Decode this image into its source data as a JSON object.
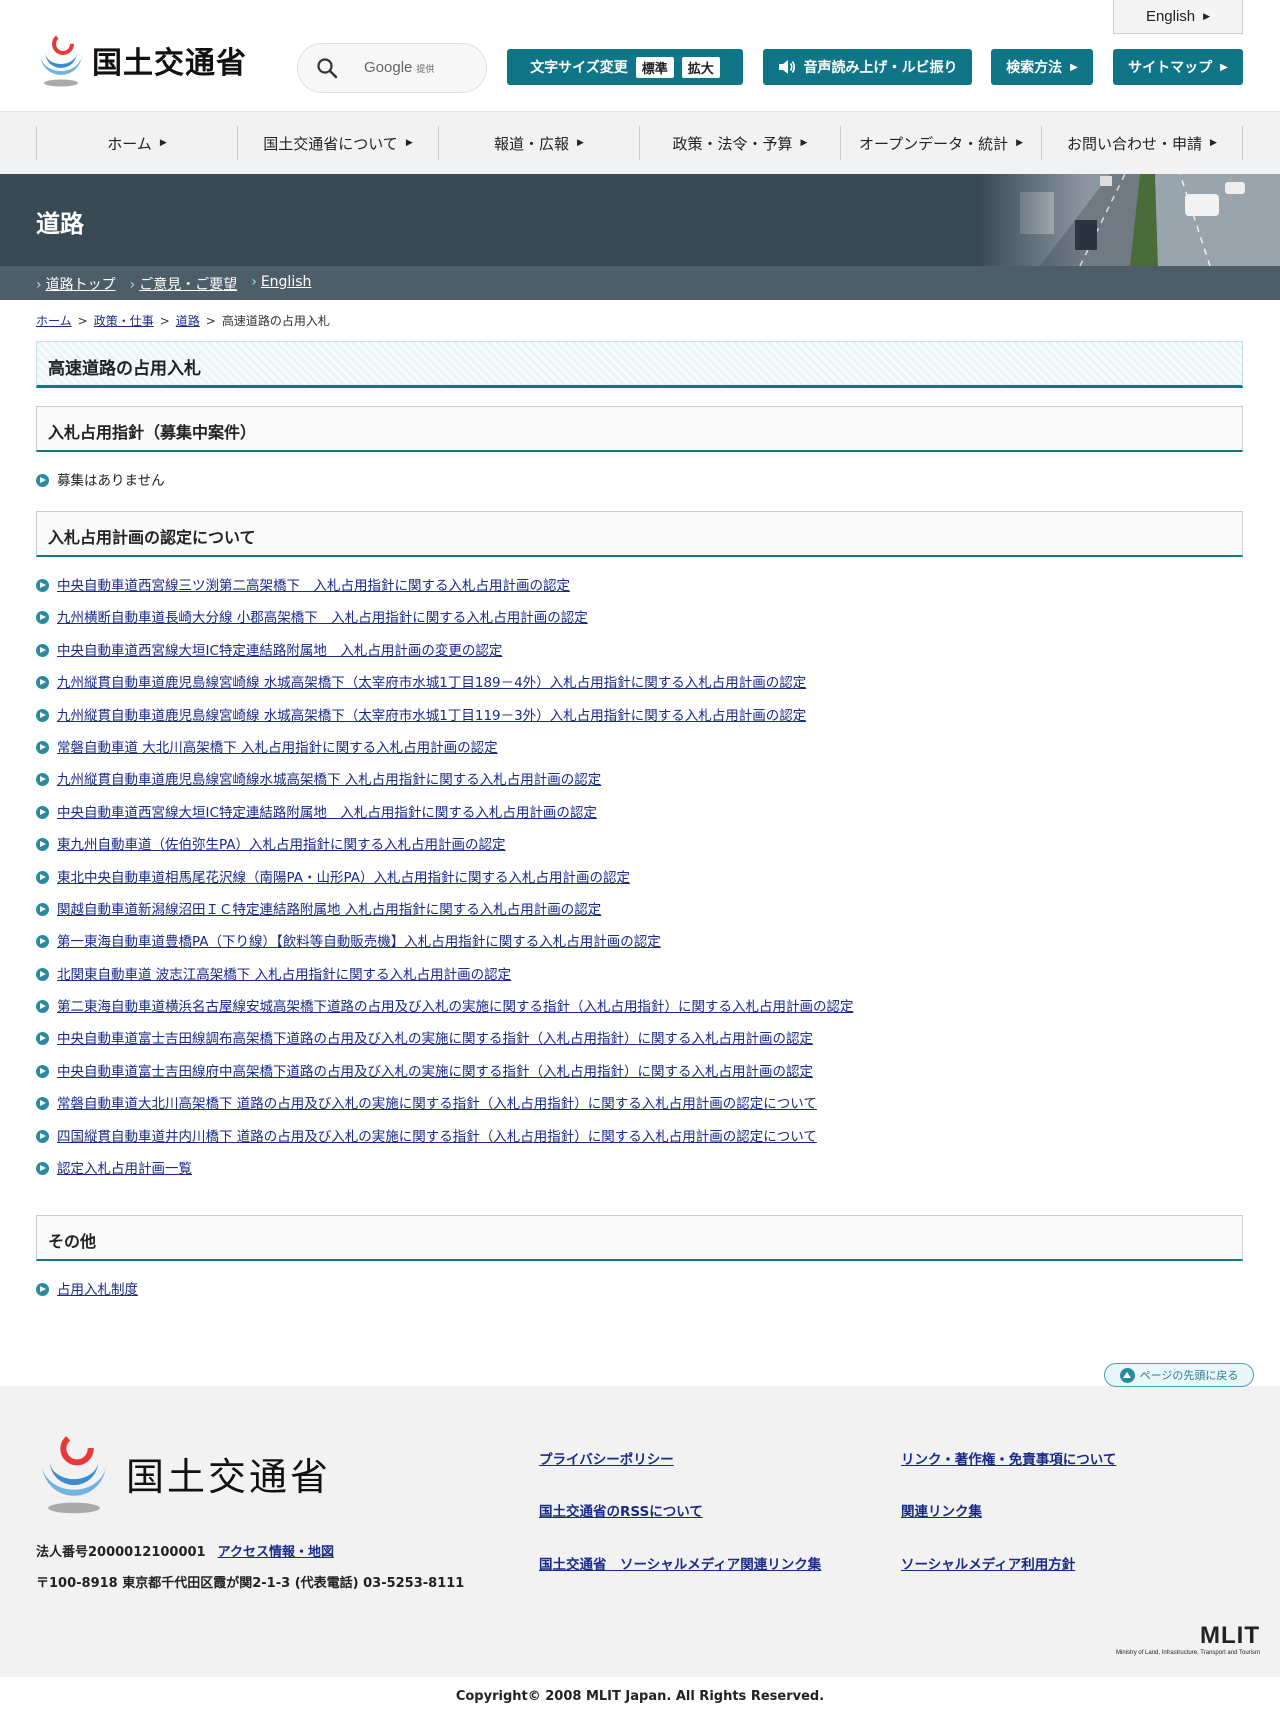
{
  "header": {
    "logo_text": "国土交通省",
    "search_provider": "Google",
    "search_provider_note": "提供",
    "font_size_label": "文字サイズ変更",
    "font_size_standard": "標準",
    "font_size_large": "拡大",
    "speech_label": "音声読み上げ・ルビ振り",
    "search_method_label": "検索方法",
    "sitemap_label": "サイトマップ",
    "english_label": "English",
    "accent_color": "#0f7587"
  },
  "gnav": {
    "items": [
      {
        "label": "ホーム"
      },
      {
        "label": "国土交通省について"
      },
      {
        "label": "報道・広報"
      },
      {
        "label": "政策・法令・予算"
      },
      {
        "label": "オープンデータ・統計"
      },
      {
        "label": "お問い合わせ・申請"
      }
    ]
  },
  "banner": {
    "title": "道路",
    "subnav": [
      "道路トップ",
      "ご意見・ご要望",
      "English"
    ]
  },
  "breadcrumb": {
    "items": [
      "ホーム",
      "政策・仕事",
      "道路"
    ],
    "current": "高速道路の占用入札"
  },
  "main": {
    "page_title": "高速道路の占用入札",
    "sections": [
      {
        "heading": "入札占用指針（募集中案件）",
        "items": [
          "募集はありません"
        ]
      },
      {
        "heading": "入札占用計画の認定について",
        "items": [
          "中央自動車道西宮線三ツ渕第二高架橋下　入札占用指針に関する入札占用計画の認定",
          "九州横断自動車道長崎大分線 小郡高架橋下　入札占用指針に関する入札占用計画の認定",
          "中央自動車道西宮線大垣IC特定連結路附属地　入札占用計画の変更の認定",
          "九州縦貫自動車道鹿児島線宮崎線 水城高架橋下（太宰府市水城1丁目189－4外）入札占用指針に関する入札占用計画の認定",
          "九州縦貫自動車道鹿児島線宮崎線 水城高架橋下（太宰府市水城1丁目119－3外）入札占用指針に関する入札占用計画の認定",
          "常磐自動車道 大北川高架橋下 入札占用指針に関する入札占用計画の認定",
          "九州縦貫自動車道鹿児島線宮崎線水城高架橋下 入札占用指針に関する入札占用計画の認定",
          "中央自動車道西宮線大垣IC特定連結路附属地　入札占用指針に関する入札占用計画の認定",
          "東九州自動車道（佐伯弥生PA）入札占用指針に関する入札占用計画の認定",
          "東北中央自動車道相馬尾花沢線（南陽PA・山形PA）入札占用指針に関する入札占用計画の認定",
          "関越自動車道新潟線沼田ＩＣ特定連結路附属地 入札占用指針に関する入札占用計画の認定",
          "第一東海自動車道豊橋PA（下り線）【飲料等自動販売機】入札占用指針に関する入札占用計画の認定",
          "北関東自動車道 波志江高架橋下 入札占用指針に関する入札占用計画の認定",
          "第二東海自動車道横浜名古屋線安城高架橋下道路の占用及び入札の実施に関する指針（入札占用指針）に関する入札占用計画の認定",
          "中央自動車道富士吉田線調布高架橋下道路の占用及び入札の実施に関する指針（入札占用指針）に関する入札占用計画の認定",
          "中央自動車道富士吉田線府中高架橋下道路の占用及び入札の実施に関する指針（入札占用指針）に関する入札占用計画の認定",
          "常磐自動車道大北川高架橋下 道路の占用及び入札の実施に関する指針（入札占用指針）に関する入札占用計画の認定について",
          "四国縦貫自動車道井内川橋下 道路の占用及び入札の実施に関する指針（入札占用指針）に関する入札占用計画の認定について",
          "認定入札占用計画一覧"
        ]
      },
      {
        "heading": "その他",
        "items": [
          "占用入札制度"
        ]
      }
    ],
    "page_top_label": "ページの先頭に戻る"
  },
  "footer": {
    "logo_text": "国土交通省",
    "corp_number": "法人番号2000012100001",
    "access_link": "アクセス情報・地図",
    "address": "〒100-8918 東京都千代田区霞が関2-1-3 (代表電話) 03-5253-8111",
    "links_col1": [
      "プライバシーポリシー",
      "国土交通省のRSSについて",
      "国土交通省　ソーシャルメディア関連リンク集"
    ],
    "links_col2": [
      "リンク・著作権・免責事項について",
      "関連リンク集",
      "ソーシャルメディア利用方針"
    ],
    "mlit_mark": "MLIT",
    "mlit_sub": "Ministry of Land, Infrastructure, Transport and Tourism",
    "copyright": "Copyright© 2008 MLIT Japan. All Rights Reserved."
  }
}
